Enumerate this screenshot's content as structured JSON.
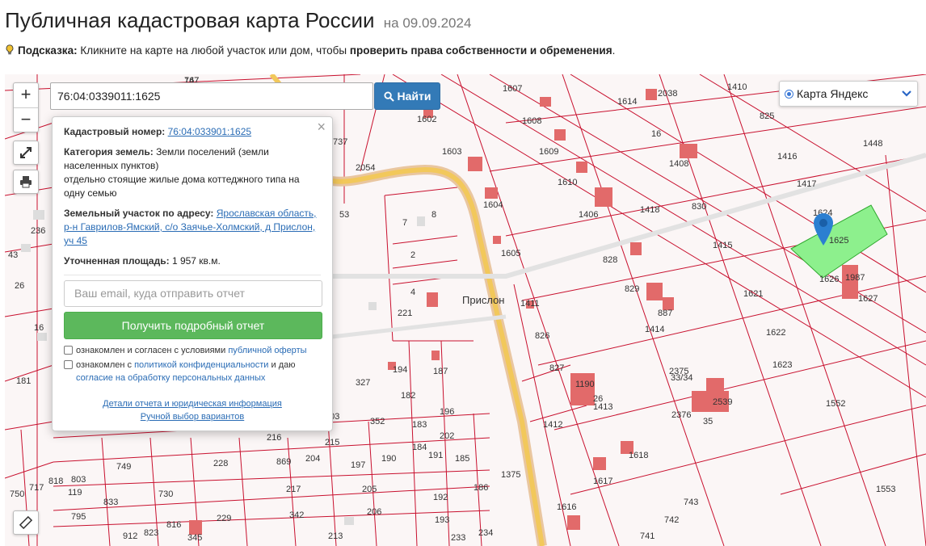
{
  "page": {
    "title": "Публичная кадастровая карта России",
    "date": "на 09.09.2024",
    "hint_label": "Подсказка:",
    "hint_text": "Кликните на карте на любой участок или дом, чтобы",
    "hint_bold": "проверить права собственности и обременения",
    "hint_end": "."
  },
  "map_controls": {
    "zoom_in": "+",
    "zoom_out": "−"
  },
  "search": {
    "value": "76:04:0339011:1625",
    "button_label": "Найти"
  },
  "layer_select": {
    "selected": "Карта Яндекс"
  },
  "popup": {
    "cad_label": "Кадастровый номер:",
    "cad_value": "76:04:033901:1625",
    "category_label": "Категория земель:",
    "category_value": "Земли поселений (земли населенных пунктов)",
    "usage": "отдельно стоящие жилые дома коттеджного типа на одну семью",
    "address_label": "Земельный участок по адресу:",
    "address_value": "Ярославская область, р-н Гаврилов-Ямский, с/о Заячье-Холмский, д Прислон, уч 45",
    "area_label": "Уточненная площадь:",
    "area_value": "1 957 кв.м.",
    "email_placeholder": "Ваш email, куда отправить отчет",
    "report_button": "Получить подробный отчет",
    "agree1_text": "ознакомлен и согласен с условиями",
    "agree1_link": "публичной оферты",
    "agree2_text": "ознакомлен с",
    "agree2_link": "политикой конфиденциальности",
    "agree2_mid": "и даю",
    "agree2_link2": "согласие на обработку персональных данных",
    "details_link": "Детали отчета и юридическая информация",
    "manual_link": "Ручной выбор вариантов",
    "close": "×"
  },
  "map_labels": {
    "village": "Прислон",
    "parcels": [
      "167",
      "1607",
      "1410",
      "825",
      "1602",
      "1614",
      "2038",
      "1608",
      "16",
      "1416",
      "1448",
      "1603",
      "1609",
      "1408",
      "1417",
      "1624",
      "1625",
      "1604",
      "1610",
      "1406",
      "1418",
      "830",
      "1415",
      "1626",
      "1987",
      "1605",
      "828",
      "829",
      "1621",
      "1627",
      "1411",
      "887",
      "1414",
      "1622",
      "826",
      "1623",
      "827",
      "2375",
      "33/34",
      "1190",
      "26",
      "1413",
      "2539",
      "2376",
      "35",
      "1412",
      "1552",
      "1618",
      "1617",
      "1616",
      "743",
      "742",
      "741",
      "1553",
      "1375",
      "2054",
      "737",
      "7",
      "8",
      "2",
      "4",
      "221",
      "53",
      "236",
      "43",
      "26",
      "16",
      "181",
      "187",
      "194",
      "327",
      "182",
      "196",
      "352",
      "183",
      "202",
      "203",
      "215",
      "216",
      "869",
      "204",
      "197",
      "190",
      "184",
      "191",
      "185",
      "228",
      "217",
      "205",
      "192",
      "186",
      "206",
      "193",
      "213",
      "234",
      "233",
      "229",
      "342",
      "345",
      "912",
      "823",
      "816",
      "730",
      "833",
      "795",
      "803",
      "749",
      "818",
      "750",
      "717",
      "119",
      "747"
    ]
  },
  "colors": {
    "parcel_line": "#c8102e",
    "building": "#e26a6a",
    "road": "#f2c85b",
    "selected_parcel": "#8df08d",
    "pin": "#2b7fd1"
  }
}
